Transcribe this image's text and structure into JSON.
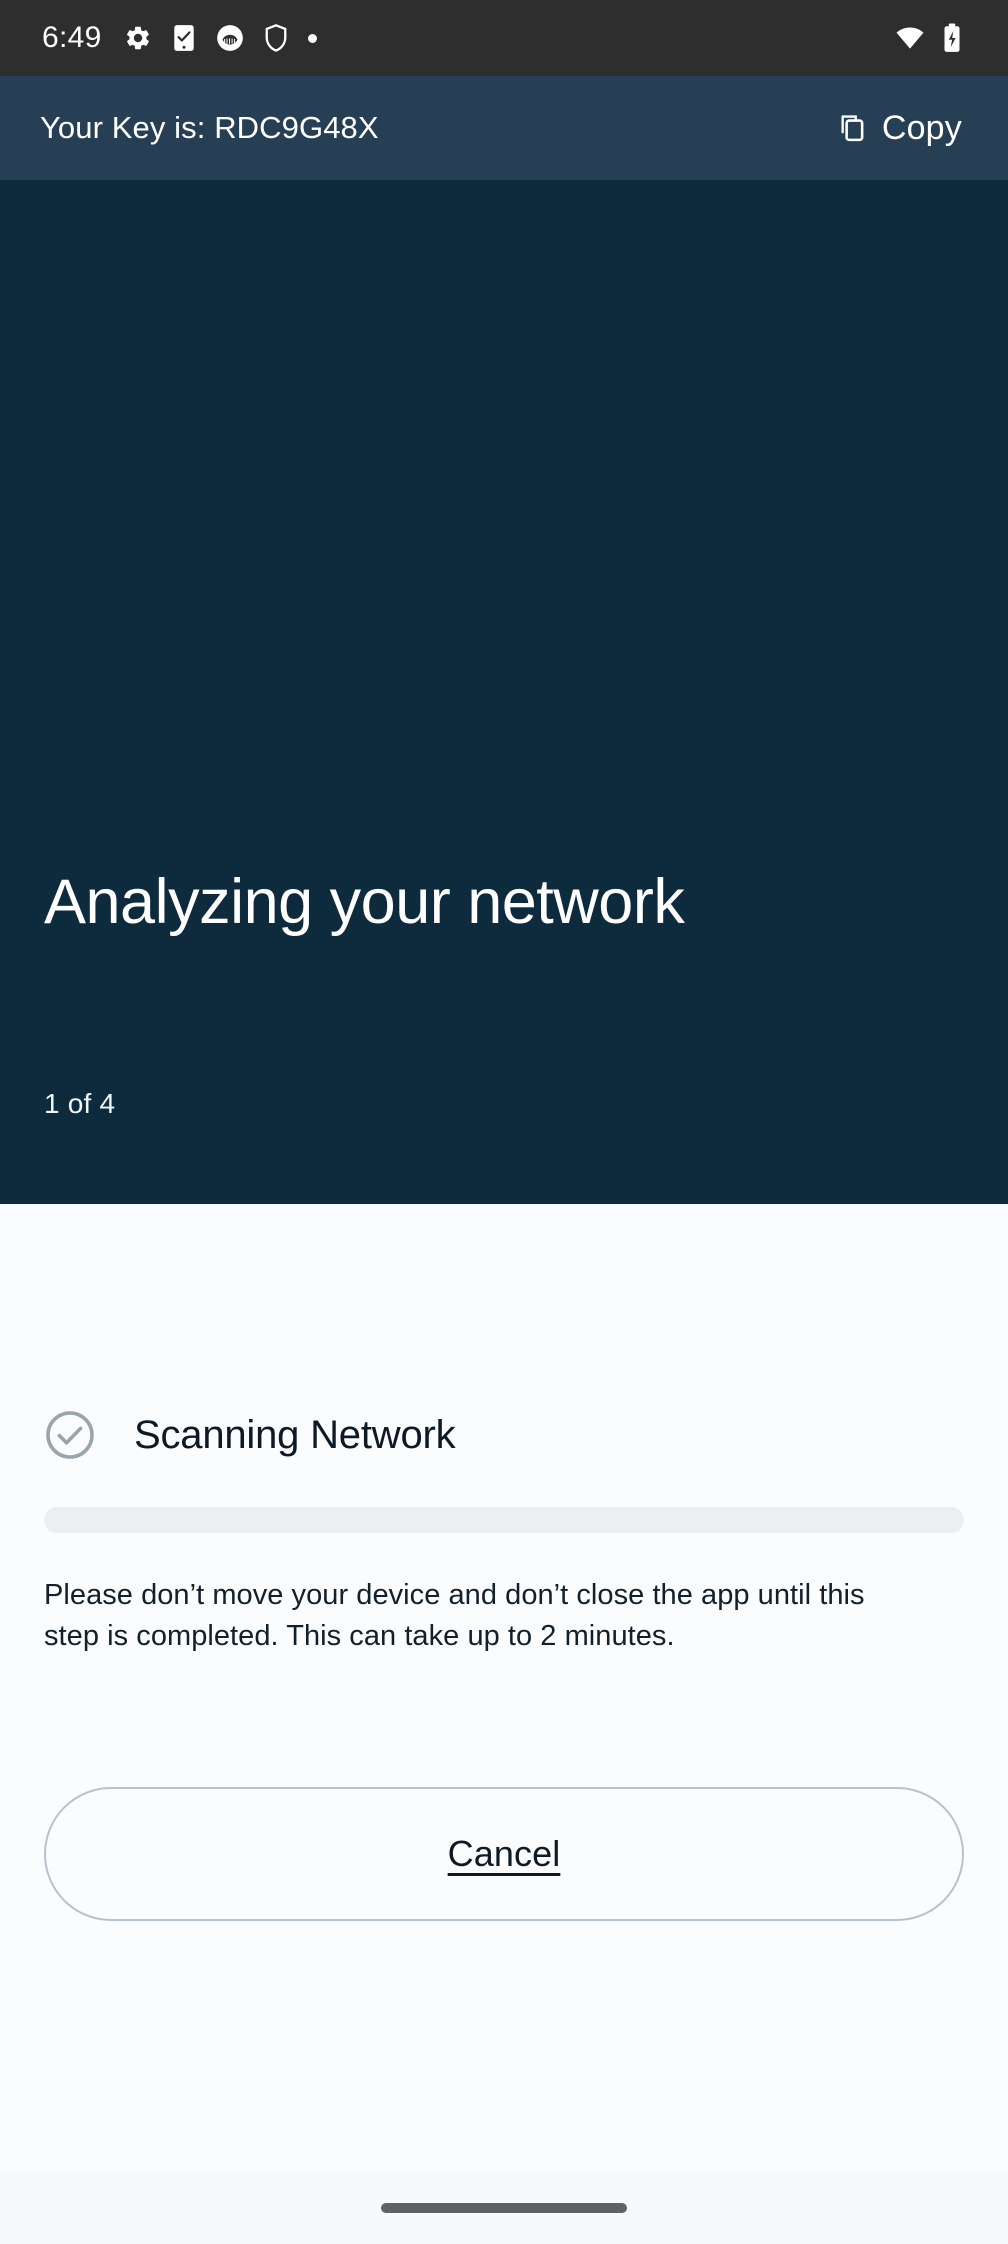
{
  "status_bar": {
    "time": "6:49",
    "left_icons": [
      {
        "name": "settings-gear-icon",
        "glyph": "gear"
      },
      {
        "name": "phone-check-icon",
        "glyph": "phone-check"
      },
      {
        "name": "app-badge-icon",
        "glyph": "circle-app"
      },
      {
        "name": "shield-icon",
        "glyph": "shield"
      },
      {
        "name": "overflow-dot-icon",
        "glyph": "dot"
      }
    ],
    "right_icons": [
      {
        "name": "wifi-icon",
        "glyph": "wifi"
      },
      {
        "name": "battery-charging-icon",
        "glyph": "battery-bolt"
      }
    ]
  },
  "key_bar": {
    "key_text": "Your Key is: RDC9G48X",
    "key_value": "RDC9G48X",
    "copy_label": "Copy",
    "copy_icon": "copy-icon",
    "background_color": "#263f54"
  },
  "hero": {
    "title": "Analyzing your network",
    "step_indicator": "1 of 4",
    "current_step": 1,
    "total_steps": 4,
    "background_color": "#0e2a3d"
  },
  "content": {
    "step": {
      "icon": "circle-check-icon",
      "label": "Scanning Network",
      "icon_color": "#9aa5ab"
    },
    "progress": {
      "percent": 0,
      "track_color": "#eceff2",
      "fill_color": "#1b5e8c"
    },
    "help_text": "Please don’t move your device and don’t close the app until this step is completed. This can take up to 2 minutes.",
    "cancel_label": "Cancel"
  },
  "nav_bar": {
    "handle": "gesture-handle"
  }
}
